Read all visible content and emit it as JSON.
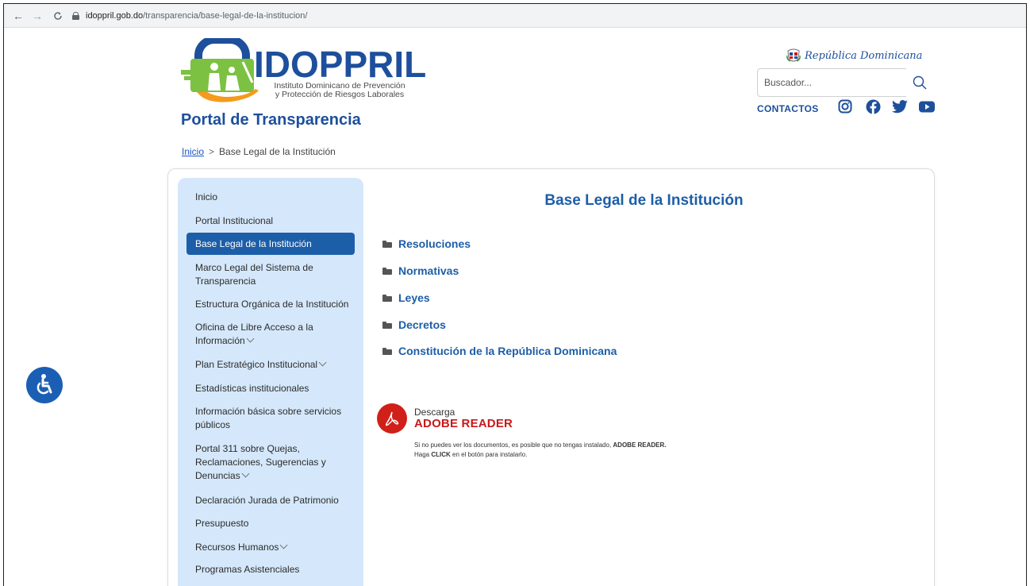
{
  "browser": {
    "host": "idoppril.gob.do",
    "path": "/transparencia/base-legal-de-la-institucion/"
  },
  "header": {
    "logo_title": "IDOPPRIL",
    "logo_subtitle_1": "Instituto Dominicano de Prevención",
    "logo_subtitle_2": "y Protección de Riesgos Laborales",
    "portal_title": "Portal de Transparencia",
    "republica": "República Dominicana",
    "search_placeholder": "Buscador...",
    "contactos": "CONTACTOS",
    "social": [
      "instagram-icon",
      "facebook-icon",
      "twitter-icon",
      "youtube-icon"
    ]
  },
  "breadcrumb": {
    "home": "Inicio",
    "separator": ">",
    "current": "Base Legal de la Institución"
  },
  "sidebar": {
    "items": [
      {
        "label": "Inicio"
      },
      {
        "label": "Portal Institucional"
      },
      {
        "label": "Base Legal de la Institución",
        "active": true
      },
      {
        "label": "Marco Legal del Sistema de Transparencia"
      },
      {
        "label": "Estructura Orgánica de la Institución"
      },
      {
        "label": "Oficina de Libre Acceso a la Información",
        "dropdown": true
      },
      {
        "label": "Plan Estratégico Institucional",
        "dropdown": true
      },
      {
        "label": "Estadísticas institucionales"
      },
      {
        "label": "Información básica sobre servicios públicos"
      },
      {
        "label": "Portal 311 sobre Quejas, Reclamaciones, Sugerencias y Denuncias",
        "dropdown": true
      },
      {
        "label": "Declaración Jurada de Patrimonio"
      },
      {
        "label": "Presupuesto"
      },
      {
        "label": "Recursos Humanos",
        "dropdown": true
      },
      {
        "label": "Programas Asistenciales"
      }
    ]
  },
  "main": {
    "title": "Base Legal de la Institución",
    "folders": [
      "Resoluciones",
      "Normativas",
      "Leyes",
      "Decretos",
      "Constitución de la República Dominicana"
    ]
  },
  "adobe": {
    "download": "Descarga",
    "name": "ADOBE READER",
    "note_1a": "Si no puedes ver los documentos, es posible que no tengas instalado, ",
    "note_1b": "ADOBE READER.",
    "note_2a": "Haga ",
    "note_2b": "CLICK",
    "note_2c": " en el botón para instalarlo."
  },
  "colors": {
    "brand_blue": "#1d5ea8",
    "sidebar_bg": "#d5e8fb",
    "adobe_red": "#d0201a",
    "logo_green": "#7dc142",
    "logo_orange": "#f59a1b"
  }
}
